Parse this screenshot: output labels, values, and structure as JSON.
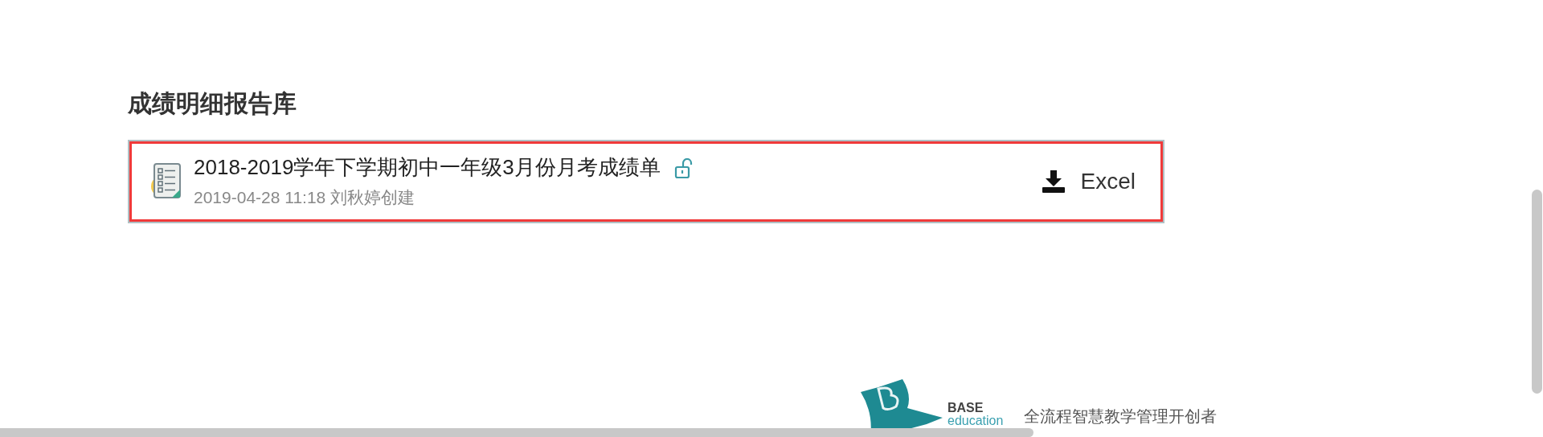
{
  "section_title": "成绩明细报告库",
  "reports": [
    {
      "title": "2018-2019学年下学期初中一年级3月份月考成绩单",
      "locked": false,
      "meta": "2019-04-28 11:18 刘秋婷创建",
      "download_label": "Excel",
      "selected": true
    }
  ],
  "footer": {
    "logo_top": "BASE",
    "logo_bottom": "education",
    "tagline": "全流程智慧教学管理开创者"
  }
}
